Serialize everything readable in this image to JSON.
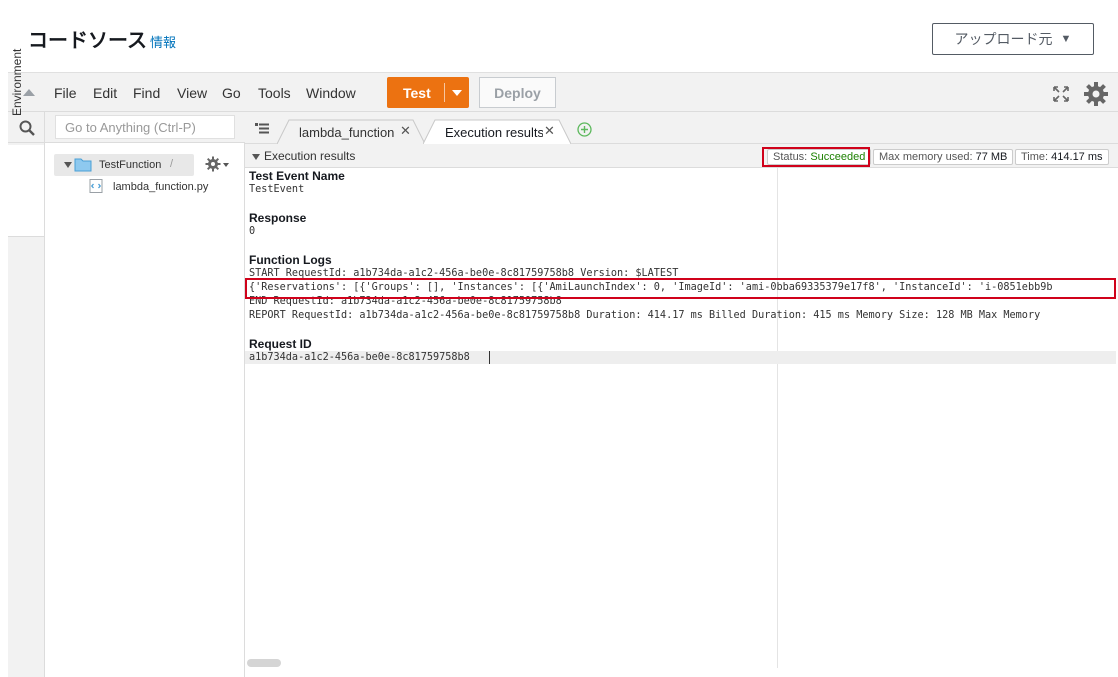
{
  "header": {
    "title": "コードソース",
    "info": "情報",
    "upload_label": "アップロード元"
  },
  "menu": {
    "items": [
      "File",
      "Edit",
      "Find",
      "View",
      "Go",
      "Tools",
      "Window"
    ],
    "test_label": "Test",
    "deploy_label": "Deploy"
  },
  "sidebar": {
    "search_placeholder": "Go to Anything (Ctrl-P)",
    "environment_tab": "Environment",
    "tree": {
      "root": "TestFunction",
      "root_path": "/",
      "files": [
        "lambda_function.py"
      ]
    }
  },
  "tabs": [
    {
      "label": "lambda_function",
      "active": false
    },
    {
      "label": "Execution results",
      "active": true
    }
  ],
  "results": {
    "title": "Execution results",
    "status_label": "Status:",
    "status_value": "Succeeded",
    "memory_label": "Max memory used:",
    "memory_value": "77 MB",
    "time_label": "Time:",
    "time_value": "414.17 ms",
    "sections": {
      "test_event_title": "Test Event Name",
      "test_event_value": "TestEvent",
      "response_title": "Response",
      "response_value": "0",
      "logs_title": "Function Logs",
      "logs": [
        "START RequestId: a1b734da-a1c2-456a-be0e-8c81759758b8 Version: $LATEST",
        "{'Reservations': [{'Groups': [], 'Instances': [{'AmiLaunchIndex': 0, 'ImageId': 'ami-0bba69335379e17f8', 'InstanceId': 'i-0851ebb9b",
        "END RequestId: a1b734da-a1c2-456a-be0e-8c81759758b8",
        "REPORT RequestId: a1b734da-a1c2-456a-be0e-8c81759758b8  Duration: 414.17 ms Billed Duration: 415 ms Memory Size: 128 MB Max Memory"
      ],
      "request_id_title": "Request ID",
      "request_id_value": "a1b734da-a1c2-456a-be0e-8c81759758b8"
    }
  },
  "colors": {
    "accent": "#ec7211",
    "success": "#1d8102",
    "highlight": "#d0021b",
    "link": "#0073bb"
  }
}
